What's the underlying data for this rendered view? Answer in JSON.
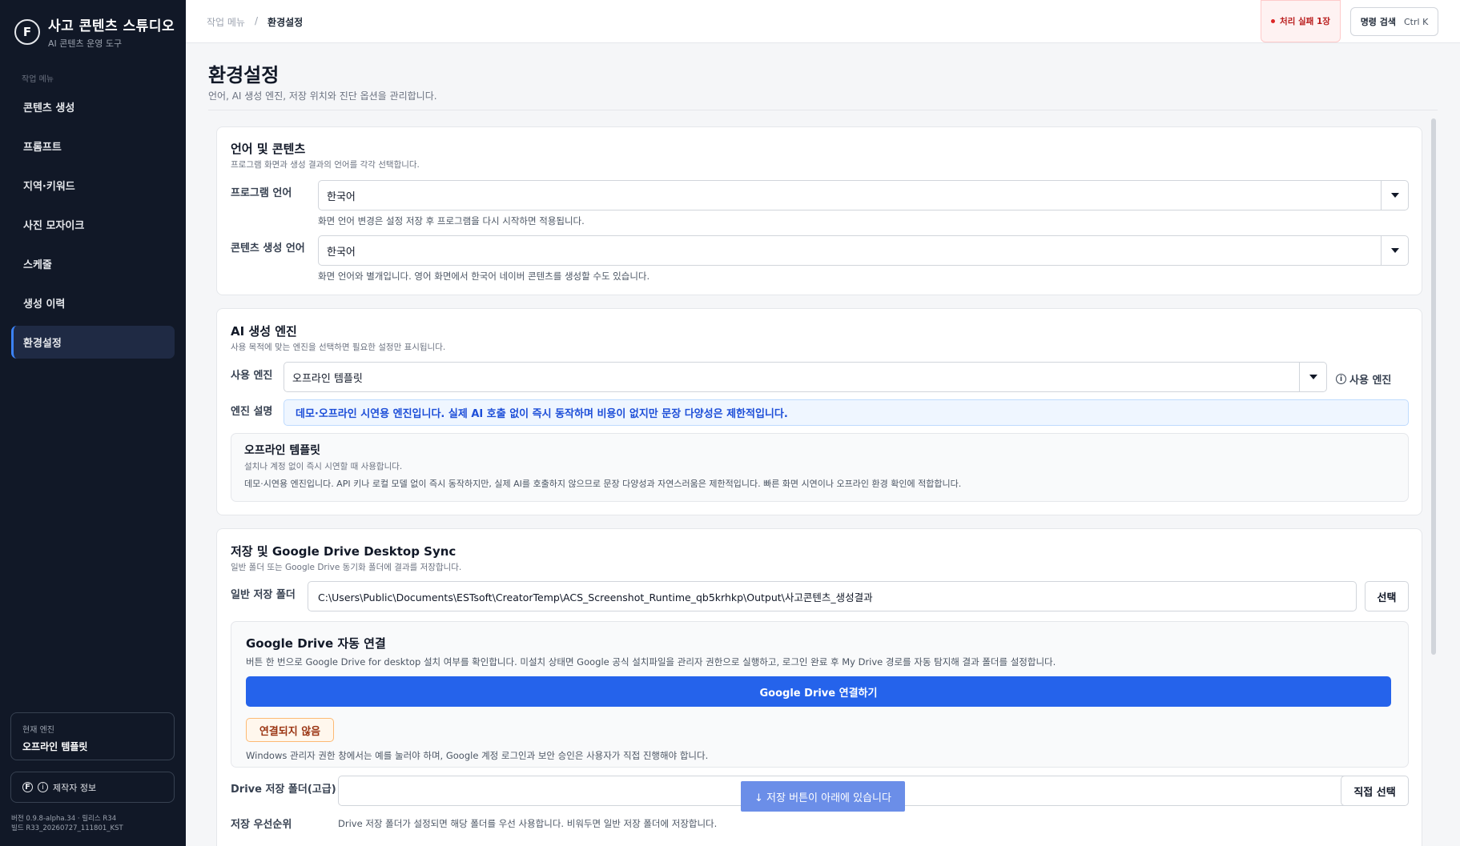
{
  "app": {
    "title": "사고 콘텐츠 스튜디오",
    "subtitle": "AI 콘텐츠 운영 도구",
    "logo_glyph": "F"
  },
  "sidebar": {
    "section_label": "작업 메뉴",
    "items": [
      {
        "label": "콘텐츠 생성",
        "active": false
      },
      {
        "label": "프롬프트",
        "active": false
      },
      {
        "label": "지역·키워드",
        "active": false
      },
      {
        "label": "사진 모자이크",
        "active": false
      },
      {
        "label": "스케줄",
        "active": false
      },
      {
        "label": "생성 이력",
        "active": false
      },
      {
        "label": "환경설정",
        "active": true
      }
    ],
    "engine_label": "현재 엔진",
    "engine_value": "오프라인 템플릿",
    "maker_label": "제작자 정보",
    "version_line1": "버전 0.9.8-alpha.34 · 릴리스 R34",
    "version_line2": "빌드 R33_20260727_111801_KST"
  },
  "topbar": {
    "breadcrumb_root": "작업 메뉴",
    "breadcrumb_sep": "/",
    "breadcrumb_current": "환경설정",
    "fail_badge": "처리 실패 1장",
    "command_label": "명령 검색",
    "command_shortcut": "Ctrl K"
  },
  "page": {
    "title": "환경설정",
    "subtitle": "언어, AI 생성 엔진, 저장 위치와 진단 옵션을 관리합니다."
  },
  "language": {
    "title": "언어 및 콘텐츠",
    "subtitle": "프로그램 화면과 생성 결과의 언어를 각각 선택합니다.",
    "program_label": "프로그램 언어",
    "program_value": "한국어",
    "program_hint": "화면 언어 변경은 설정 저장 후 프로그램을 다시 시작하면 적용됩니다.",
    "content_label": "콘텐츠 생성 언어",
    "content_value": "한국어",
    "content_hint": "화면 언어와 별개입니다. 영어 화면에서 한국어 네이버 콘텐츠를 생성할 수도 있습니다."
  },
  "ai": {
    "title": "AI 생성 엔진",
    "subtitle": "사용 목적에 맞는 엔진을 선택하면 필요한 설정만 표시됩니다.",
    "engine_label": "사용 엔진",
    "engine_value": "오프라인 템플릿",
    "engine_info": "사용 엔진",
    "desc_label": "엔진 설명",
    "desc_text": "데모·오프라인 시연용 엔진입니다. 실제 AI 호출 없이 즉시 동작하며 비용이 없지만 문장 다양성은 제한적입니다.",
    "detail_title": "오프라인 템플릿",
    "detail_sub": "설치나 계정 없이 즉시 시연할 때 사용합니다.",
    "detail_text": "데모·시연용 엔진입니다. API 키나 로컬 모델 없이 즉시 동작하지만, 실제 AI를 호출하지 않으므로 문장 다양성과 자연스러움은 제한적입니다. 빠른 화면 시연이나 오프라인 환경 확인에 적합합니다."
  },
  "storage": {
    "title": "저장 및 Google Drive Desktop Sync",
    "subtitle": "일반 폴더 또는 Google Drive 동기화 폴더에 결과를 저장합니다.",
    "folder_label": "일반 저장 폴더",
    "folder_value": "C:\\Users\\Public\\Documents\\ESTsoft\\CreatorTemp\\ACS_Screenshot_Runtime_qb5krhkp\\Output\\사고콘텐츠_생성결과",
    "select_button": "선택",
    "gd_title": "Google Drive 자동 연결",
    "gd_desc": "버튼 한 번으로 Google Drive for desktop 설치 여부를 확인합니다. 미설치 상태면 Google 공식 설치파일을 관리자 권한으로 실행하고, 로그인 완료 후 My Drive 경로를 자동 탐지해 결과 폴더를 설정합니다.",
    "gd_button": "Google Drive 연결하기",
    "gd_status": "연결되지 않음",
    "gd_note": "Windows 관리자 권한 창에서는 예를 눌러야 하며, Google 계정 로그인과 보안 승인은 사용자가 직접 진행해야 합니다.",
    "drive_folder_label": "Drive 저장 폴더(고급)",
    "drive_folder_value": "",
    "direct_select_button": "직접 선택",
    "priority_label": "저장 우선순위",
    "priority_text": "Drive 저장 폴더가 설정되면 해당 폴더를 우선 사용합니다. 비워두면 일반 저장 폴더에 저장합니다."
  },
  "floating_hint": "↓ 저장 버튼이 아래에 있습니다",
  "colors": {
    "sidebar_bg": "#111827",
    "accent": "#2563eb",
    "danger": "#dc2626"
  }
}
